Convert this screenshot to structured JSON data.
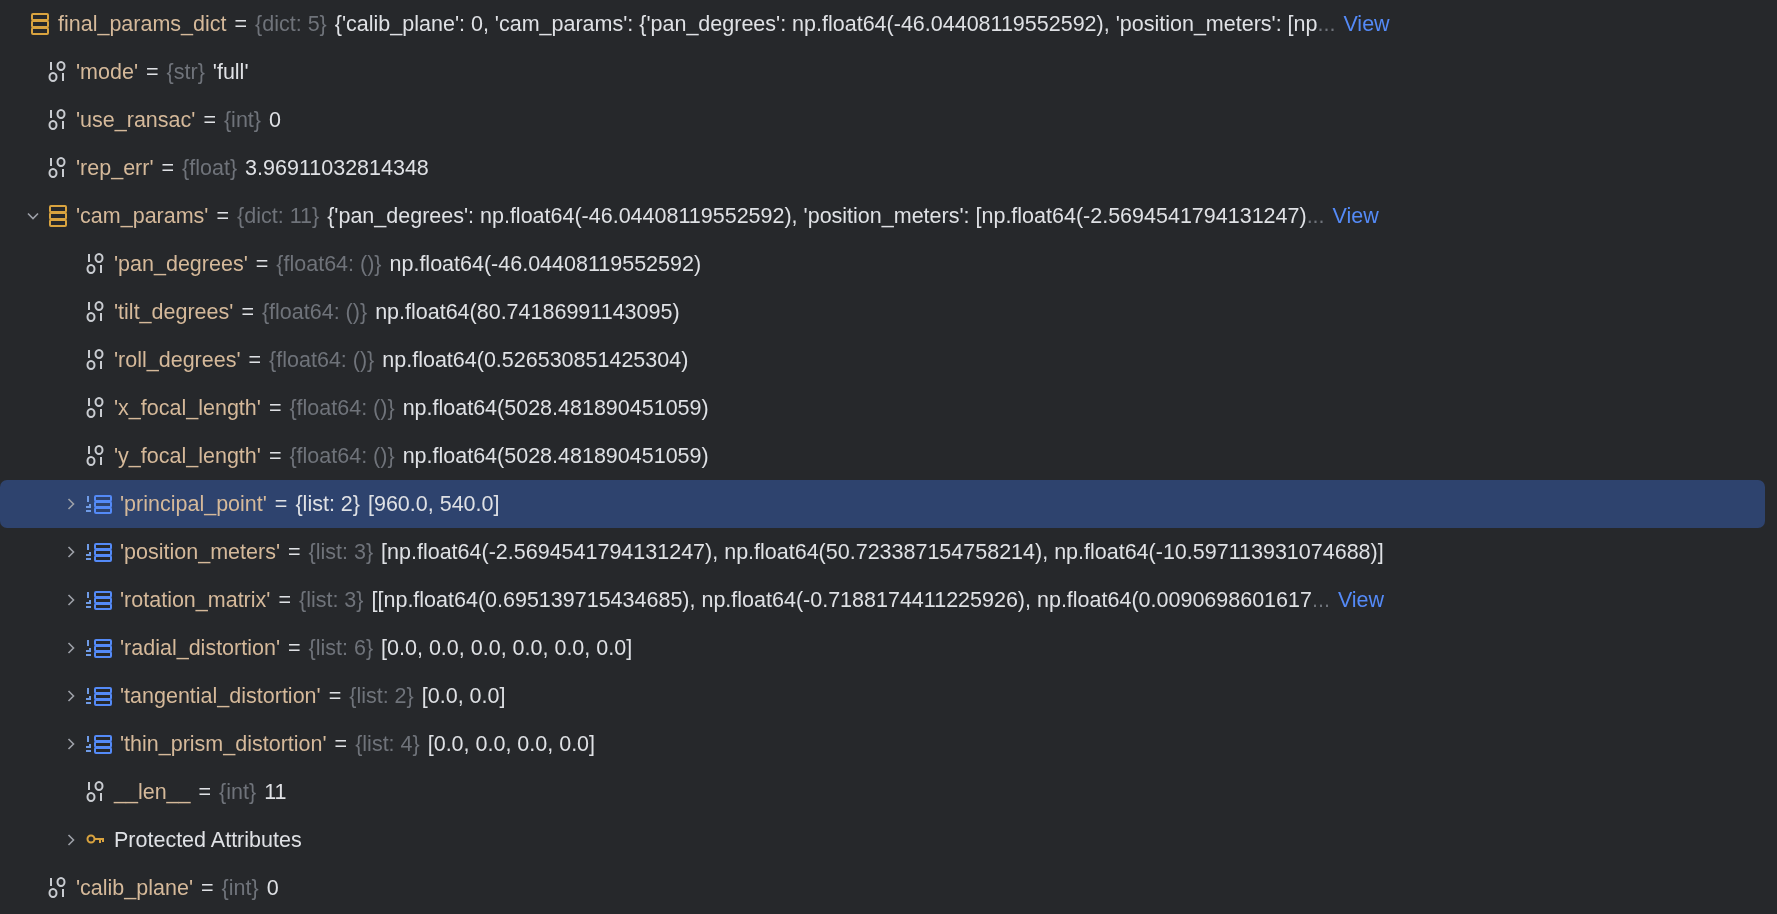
{
  "tree": [
    {
      "kind": "dict",
      "name": "final_params_dict",
      "separator": "=",
      "type": "{dict: 5}",
      "value": "{'calib_plane': 0, 'cam_params': {'pan_degrees': np.float64(-46.04408119552592), 'position_meters': [np",
      "ellipsis": "...",
      "link": "View",
      "selected": false,
      "children": [
        {
          "kind": "scalar",
          "name": "'mode'",
          "separator": "=",
          "type": "{str}",
          "value": "'full'",
          "selected": false
        },
        {
          "kind": "scalar",
          "name": "'use_ransac'",
          "separator": "=",
          "type": "{int}",
          "value": "0",
          "selected": false
        },
        {
          "kind": "scalar",
          "name": "'rep_err'",
          "separator": "=",
          "type": "{float}",
          "value": "3.96911032814348",
          "selected": false
        },
        {
          "kind": "dict",
          "name": "'cam_params'",
          "separator": "=",
          "type": "{dict: 11}",
          "value": "{'pan_degrees': np.float64(-46.04408119552592), 'position_meters': [np.float64(-2.5694541794131247)",
          "ellipsis": "...",
          "link": "View",
          "expanded": true,
          "selected": false,
          "children": [
            {
              "kind": "scalar",
              "name": "'pan_degrees'",
              "separator": "=",
              "type": "{float64: ()}",
              "value": "np.float64(-46.04408119552592)",
              "selected": false
            },
            {
              "kind": "scalar",
              "name": "'tilt_degrees'",
              "separator": "=",
              "type": "{float64: ()}",
              "value": "np.float64(80.74186991143095)",
              "selected": false
            },
            {
              "kind": "scalar",
              "name": "'roll_degrees'",
              "separator": "=",
              "type": "{float64: ()}",
              "value": "np.float64(0.526530851425304)",
              "selected": false
            },
            {
              "kind": "scalar",
              "name": "'x_focal_length'",
              "separator": "=",
              "type": "{float64: ()}",
              "value": "np.float64(5028.481890451059)",
              "selected": false
            },
            {
              "kind": "scalar",
              "name": "'y_focal_length'",
              "separator": "=",
              "type": "{float64: ()}",
              "value": "np.float64(5028.481890451059)",
              "selected": false
            },
            {
              "kind": "list",
              "name": "'principal_point'",
              "separator": "=",
              "type": "{list: 2}",
              "value": "[960.0, 540.0]",
              "expanded": false,
              "selected": true
            },
            {
              "kind": "list",
              "name": "'position_meters'",
              "separator": "=",
              "type": "{list: 3}",
              "value": "[np.float64(-2.5694541794131247), np.float64(50.723387154758214), np.float64(-10.597113931074688)]",
              "expanded": false,
              "selected": false
            },
            {
              "kind": "list",
              "name": "'rotation_matrix'",
              "separator": "=",
              "type": "{list: 3}",
              "value": "[[np.float64(0.695139715434685), np.float64(-0.7188174411225926), np.float64(0.0090698601617",
              "ellipsis": "...",
              "link": "View",
              "expanded": false,
              "selected": false
            },
            {
              "kind": "list",
              "name": "'radial_distortion'",
              "separator": "=",
              "type": "{list: 6}",
              "value": "[0.0, 0.0, 0.0, 0.0, 0.0, 0.0]",
              "expanded": false,
              "selected": false
            },
            {
              "kind": "list",
              "name": "'tangential_distortion'",
              "separator": "=",
              "type": "{list: 2}",
              "value": "[0.0, 0.0]",
              "expanded": false,
              "selected": false
            },
            {
              "kind": "list",
              "name": "'thin_prism_distortion'",
              "separator": "=",
              "type": "{list: 4}",
              "value": "[0.0, 0.0, 0.0, 0.0]",
              "expanded": false,
              "selected": false
            },
            {
              "kind": "scalar",
              "name": "__len__",
              "separator": "=",
              "type": "{int}",
              "value": "11",
              "selected": false
            },
            {
              "kind": "group",
              "name": "Protected Attributes",
              "expanded": false,
              "selected": false
            }
          ]
        },
        {
          "kind": "scalar",
          "name": "'calib_plane'",
          "separator": "=",
          "type": "{int}",
          "value": "0",
          "selected": false
        }
      ]
    }
  ]
}
